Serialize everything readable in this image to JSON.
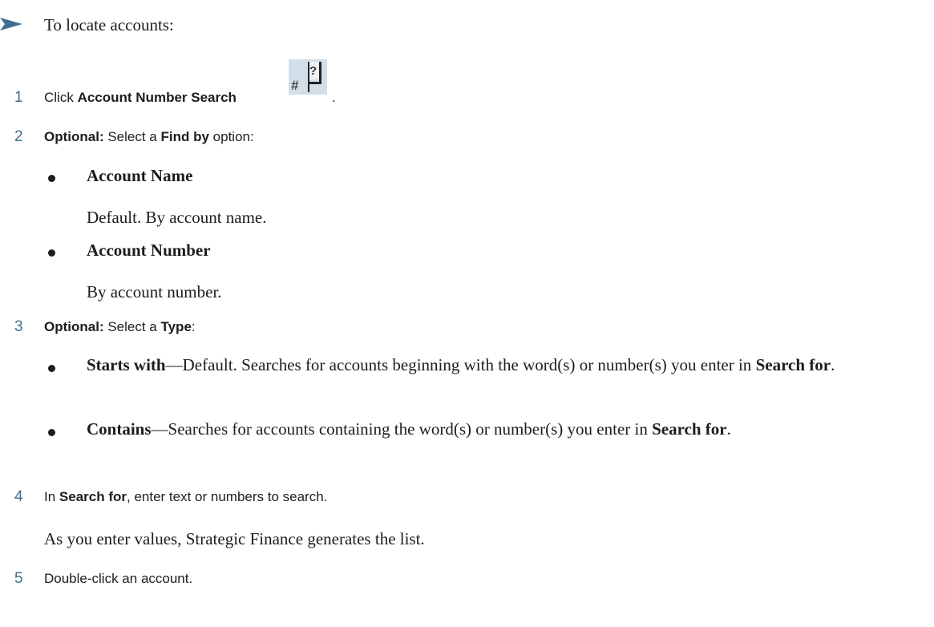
{
  "intro": {
    "text": "To locate accounts:"
  },
  "steps": [
    {
      "number": "1",
      "text_prefix": "Click ",
      "label": "Account Number Search",
      "text_suffix": " .",
      "icon": "account-number-search-icon"
    },
    {
      "number": "2",
      "optional": "Optional:",
      "text_a": " Select a ",
      "label": "Find by",
      "text_b": " option:"
    },
    {
      "number": "3",
      "optional": "Optional:",
      "text_a": " Select a ",
      "label": "Type",
      "text_b": ":"
    },
    {
      "number": "4",
      "text_a": "In ",
      "label": "Search for",
      "text_b": ", enter text or numbers to search."
    },
    {
      "number": "5",
      "text": "Double-click an account."
    }
  ],
  "find_by_options": [
    {
      "name": "Account Name",
      "description": "Default. By account name."
    },
    {
      "name": "Account Number",
      "description": "By account number."
    }
  ],
  "type_options": [
    {
      "name": "Starts with",
      "dash": "—",
      "description": "Default. Searches for accounts beginning with the word(s) or number(s) you enter in ",
      "field": "Search for",
      "end": "."
    },
    {
      "name": "Contains",
      "dash": "—",
      "description": "Searches for accounts containing the word(s) or number(s) you enter in ",
      "field": "Search for",
      "end": "."
    }
  ],
  "step4_note": "As you enter values, Strategic Finance generates the list."
}
